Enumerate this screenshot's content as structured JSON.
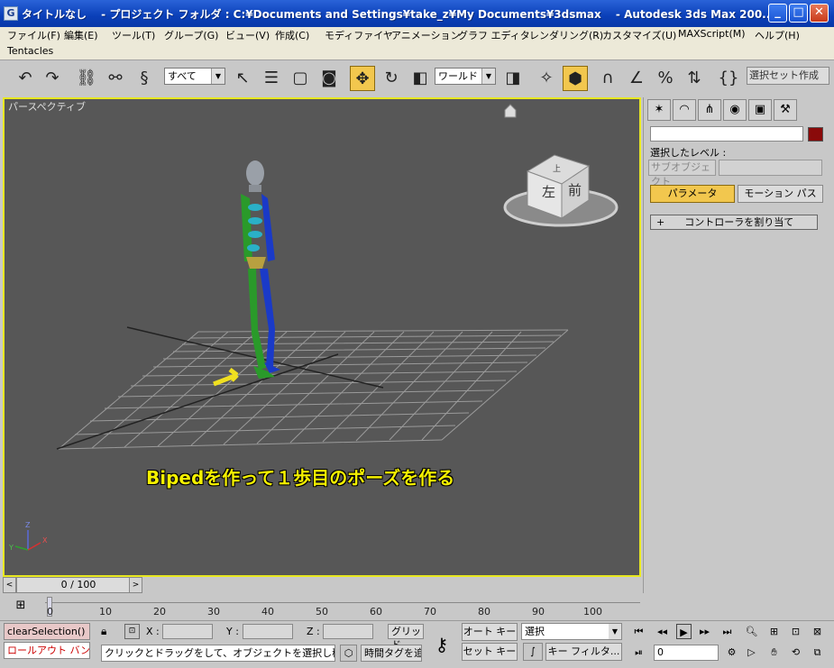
{
  "window": {
    "title": "タイトルなし　 - プロジェクト フォルダ : C:¥Documents and Settings¥take_z¥My Documents¥3dsmax　 - Autodesk 3ds Max  200..."
  },
  "menu": [
    "ファイル(F)",
    "編集(E)",
    "ツール(T)",
    "グループ(G)",
    "ビュー(V)",
    "作成(C)",
    "モディファイヤ",
    "アニメーション",
    "グラフ エディタ",
    "レンダリング(R)",
    "カスタマイズ(U)",
    "MAXScript(M)",
    "ヘルプ(H)"
  ],
  "tentacles_label": "Tentacles",
  "toolbar": {
    "filter_value": "すべて",
    "coord_system": "ワールド",
    "named_selection_placeholder": "選択セット作成"
  },
  "viewport": {
    "label": "パースペクティブ",
    "caption": "Bipedを作って１歩目のポーズを作る",
    "viewcube_left": "左",
    "viewcube_front": "前",
    "viewcube_top": "上",
    "axis_x": "X",
    "axis_y": "Y",
    "axis_z": "Z"
  },
  "command_panel": {
    "selection_level": "選択したレベル :",
    "subobject": "サブオブジェクト",
    "tab_params": "パラメータ",
    "tab_motion": "モーション パス",
    "rollout": "+　　コントローラを割り当て",
    "object_color": "#8a0a0a"
  },
  "timeline": {
    "time_display": "0 / 100",
    "ticks": [
      "0",
      "10",
      "20",
      "30",
      "40",
      "50",
      "60",
      "70",
      "80",
      "90",
      "100"
    ]
  },
  "status": {
    "maxscript_line1": "clearSelection()",
    "maxscript_line2": "ロールアウト バン",
    "x_label": "X :",
    "y_label": "Y :",
    "z_label": "Z :",
    "grid": "グリッド",
    "prompt": "クリックとドラッグをして、オブジェクトを選択し移動します",
    "time_tag": "時間タグを追加",
    "auto_key": "オート キー",
    "set_key": "セット キー",
    "key_mode": "選択",
    "key_filter": "キー フィルタ...",
    "current_frame": "0"
  }
}
